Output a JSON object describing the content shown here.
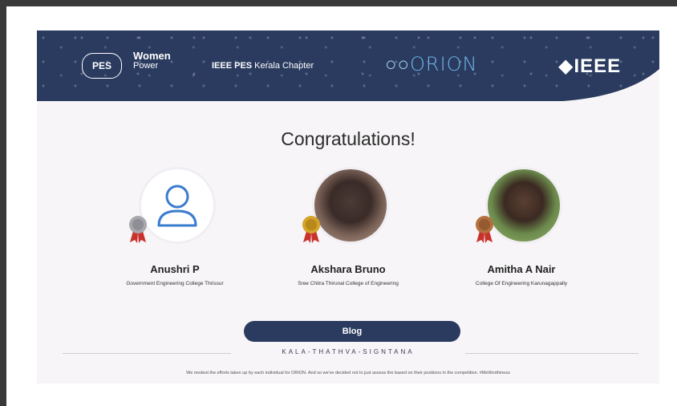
{
  "header": {
    "logos": {
      "pes": "PES",
      "women_line1": "Women",
      "women_line2": "Power",
      "chapter_bold": "IEEE PES",
      "chapter_rest": "Kerala Chapter",
      "orion": "ORION",
      "ieee": "IEEE"
    }
  },
  "title": "Congratulations!",
  "winners": [
    {
      "name": "Anushri P",
      "college": "Government Engineering College Thrissur",
      "rank": 2
    },
    {
      "name": "Akshara Bruno",
      "college": "Sree Chitra Thirunal College of Engineering",
      "rank": 1
    },
    {
      "name": "Amitha A Nair",
      "college": "College Of Engineering Karunagappally",
      "rank": 3
    }
  ],
  "blog_button": "Blog",
  "tagline": "KALA-THATHVA-SIGNTANA",
  "footnote": "We modest the efforts taken up by each individual for ORION. And so we've decided not to just assess the based on their positions in the competition. #MeWorthiness",
  "colors": {
    "navy": "#2a3b5f",
    "gold": "#d4a32a",
    "silver": "#a7a7ad",
    "bronze": "#b4703e",
    "ribbon": "#c8322c"
  }
}
